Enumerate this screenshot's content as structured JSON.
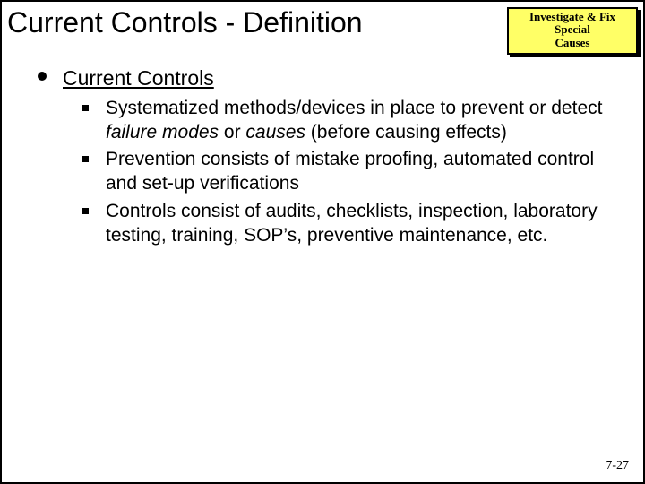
{
  "header": {
    "title": "Current Controls - Definition",
    "callout_line1": "Investigate & Fix Special",
    "callout_line2": "Causes"
  },
  "outline": {
    "label": "Current Controls",
    "bullets": [
      {
        "plain_prefix": "Systematized methods/devices in place to prevent or detect ",
        "em1": "failure modes",
        "mid": " or ",
        "em2": "causes",
        "plain_suffix": " (before causing effects)"
      },
      {
        "text": "Prevention consists of mistake proofing, automated control and set-up verifications"
      },
      {
        "text": "Controls consist of audits, checklists, inspection, laboratory testing, training, SOP’s, preventive maintenance, etc."
      }
    ]
  },
  "page_number": "7-27"
}
